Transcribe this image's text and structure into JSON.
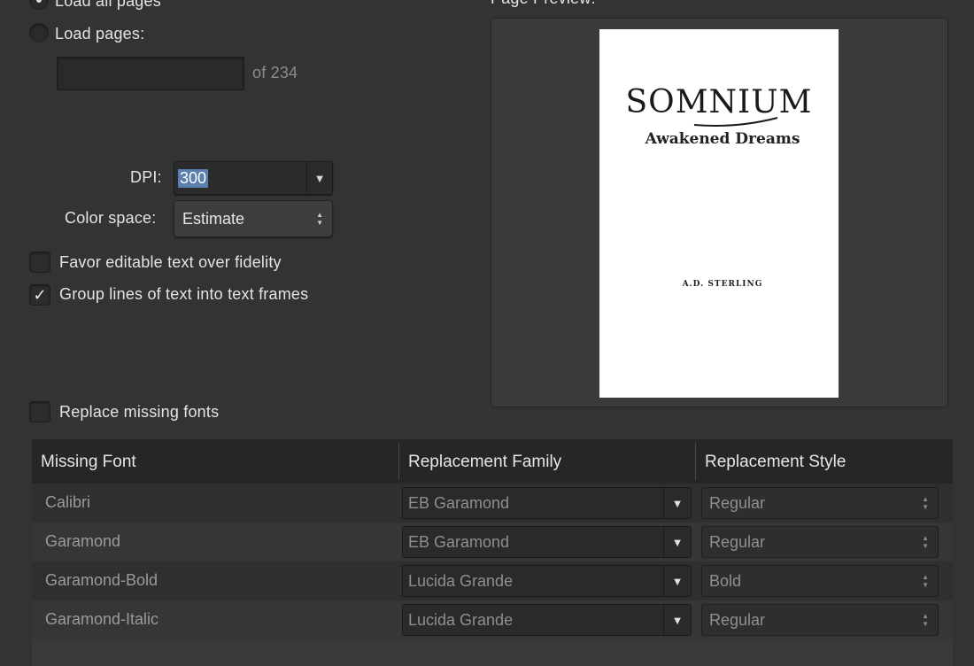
{
  "load": {
    "all_pages_label": "Load all pages",
    "pages_label": "Load pages:",
    "pages_value": "",
    "of_total": "of 234"
  },
  "dpi": {
    "label": "DPI:",
    "value": "300"
  },
  "color_space": {
    "label": "Color space:",
    "value": "Estimate"
  },
  "options": {
    "favor_editable": {
      "label": "Favor editable text over fidelity",
      "checked": false
    },
    "group_lines": {
      "label": "Group lines of text into text frames",
      "checked": true,
      "mark": "✓"
    }
  },
  "preview": {
    "label": "Page Preview:",
    "book_title": "SOMNIUM",
    "book_subtitle": "Awakened Dreams",
    "book_author": "A.D. Sterling"
  },
  "replace_fonts": {
    "label": "Replace missing fonts",
    "checked": false
  },
  "table": {
    "headers": [
      "Missing Font",
      "Replacement Family",
      "Replacement Style"
    ],
    "rows": [
      {
        "missing": "Calibri",
        "family": "EB Garamond",
        "style": "Regular"
      },
      {
        "missing": "Garamond",
        "family": "EB Garamond",
        "style": "Regular"
      },
      {
        "missing": "Garamond-Bold",
        "family": "Lucida Grande",
        "style": "Bold"
      },
      {
        "missing": "Garamond-Italic",
        "family": "Lucida Grande",
        "style": "Regular"
      }
    ]
  },
  "icons": {
    "dropdown": "▼",
    "stepper_up": "▲",
    "stepper_down": "▼"
  },
  "colors": {
    "background": "#333333",
    "selection": "#5a7fae"
  }
}
